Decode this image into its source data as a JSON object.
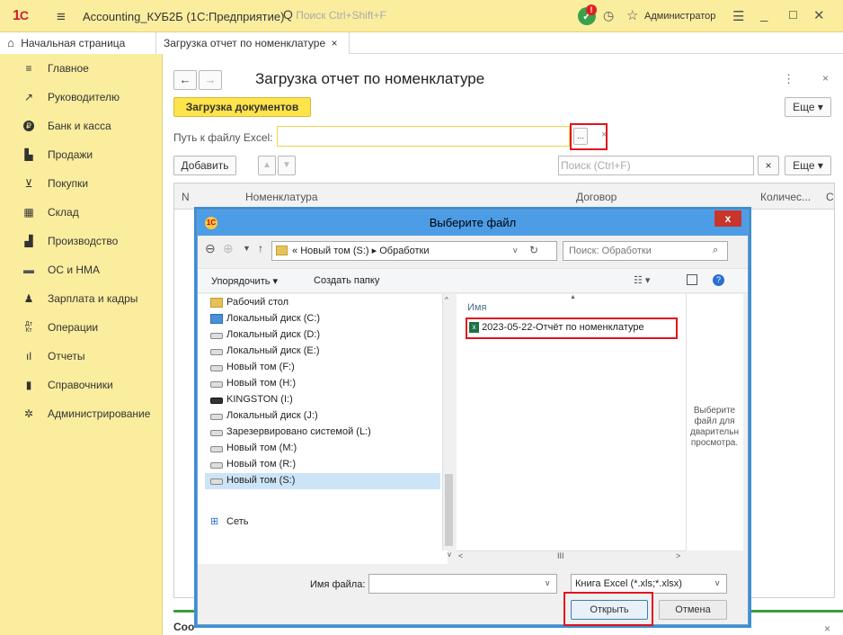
{
  "titlebar": {
    "app_title": "Accounting_КУБ2Б (1С:Предприятие)",
    "search_placeholder": "Поиск Ctrl+Shift+F",
    "user": "Администратор"
  },
  "tabs": [
    {
      "label": "Начальная страница"
    },
    {
      "label": "Загрузка отчет по номенклатуре"
    }
  ],
  "sidebar": {
    "items": [
      {
        "label": "Главное",
        "icon": "menu-lines-icon"
      },
      {
        "label": "Руководителю",
        "icon": "trend-icon"
      },
      {
        "label": "Банк и касса",
        "icon": "ruble-icon"
      },
      {
        "label": "Продажи",
        "icon": "bag-icon"
      },
      {
        "label": "Покупки",
        "icon": "cart-icon"
      },
      {
        "label": "Склад",
        "icon": "warehouse-icon"
      },
      {
        "label": "Производство",
        "icon": "factory-icon"
      },
      {
        "label": "ОС и НМА",
        "icon": "truck-icon"
      },
      {
        "label": "Зарплата и кадры",
        "icon": "person-icon"
      },
      {
        "label": "Операции",
        "icon": "dt-kt-icon"
      },
      {
        "label": "Отчеты",
        "icon": "bar-chart-icon"
      },
      {
        "label": "Справочники",
        "icon": "book-icon"
      },
      {
        "label": "Администрирование",
        "icon": "gear-icon"
      }
    ]
  },
  "form": {
    "title": "Загрузка отчет по номенклатуре",
    "load_button": "Загрузка документов",
    "more_button": "Еще",
    "path_label": "Путь к файлу Excel:",
    "path_value": "",
    "browse_label": "...",
    "clear_label": "×",
    "add_button": "Добавить",
    "table_search_placeholder": "Поиск (Ctrl+F)",
    "table_more_button": "Еще",
    "columns": [
      "N",
      "Номенклатура",
      "Договор",
      "Количес...",
      "С"
    ],
    "bottom_label": "Соо"
  },
  "dialog": {
    "title": "Выберите файл",
    "breadcrumb_prefix": "«",
    "breadcrumb": [
      "Новый том (S:)",
      "Обработки"
    ],
    "search_placeholder": "Поиск: Обработки",
    "organize": "Упорядочить",
    "new_folder": "Создать папку",
    "nav_items": [
      {
        "label": "Рабочий стол",
        "icon": "desktop-folder-icon"
      },
      {
        "label": "Локальный диск (C:)",
        "icon": "windows-drive-icon"
      },
      {
        "label": "Локальный диск (D:)",
        "icon": "drive-icon"
      },
      {
        "label": "Локальный диск (E:)",
        "icon": "drive-icon"
      },
      {
        "label": "Новый том (F:)",
        "icon": "drive-icon"
      },
      {
        "label": "Новый том (H:)",
        "icon": "drive-icon"
      },
      {
        "label": "KINGSTON (I:)",
        "icon": "usb-drive-icon"
      },
      {
        "label": "Локальный диск (J:)",
        "icon": "drive-icon"
      },
      {
        "label": "Зарезервировано системой (L:)",
        "icon": "drive-icon"
      },
      {
        "label": "Новый том (M:)",
        "icon": "drive-icon"
      },
      {
        "label": "Новый том (R:)",
        "icon": "drive-icon"
      },
      {
        "label": "Новый том (S:)",
        "icon": "drive-icon"
      }
    ],
    "network": "Сеть",
    "files_column": "Имя",
    "files": [
      {
        "name": "2023-05-22-Отчёт по номенклатуре",
        "icon": "excel-file-icon"
      }
    ],
    "preview_text_lines": [
      "Выберите",
      "файл для",
      "дварительн",
      "просмотра."
    ],
    "filename_label": "Имя файла:",
    "filename_value": "",
    "filetype": "Книга Excel (*.xls;*.xlsx)",
    "open_button": "Открыть",
    "cancel_button": "Отмена"
  },
  "colors": {
    "accent_yellow": "#fbed9e",
    "button_yellow": "#ffe34a",
    "highlight_red": "#e0121e",
    "dialog_title_blue": "#4c9de6"
  }
}
